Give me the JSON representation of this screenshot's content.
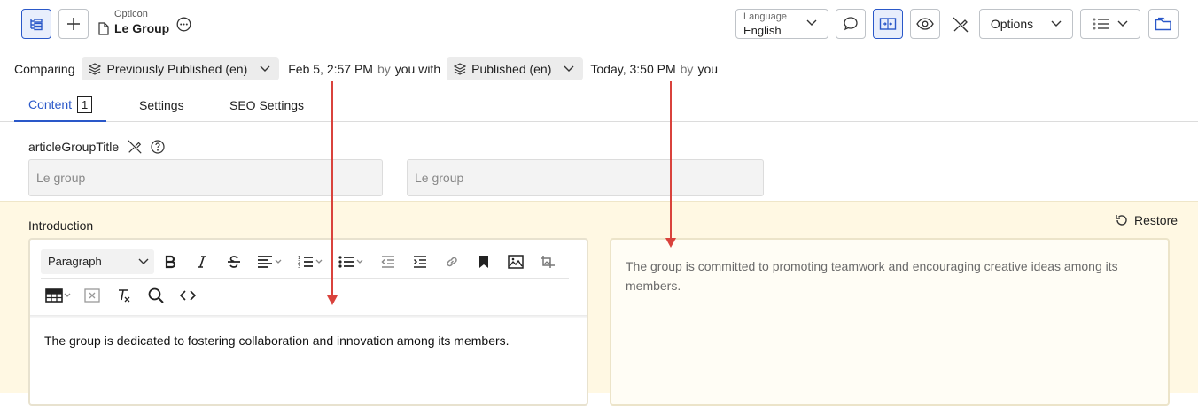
{
  "header": {
    "breadcrumb": "Opticon",
    "title": "Le Group",
    "language_label": "Language",
    "language_value": "English",
    "options_label": "Options"
  },
  "compare": {
    "label": "Comparing",
    "left_version": "Previously Published (en)",
    "left_date": "Feb 5, 2:57 PM",
    "left_by": "by",
    "left_user": "you with",
    "right_version": "Published (en)",
    "right_date": "Today, 3:50 PM",
    "right_by": "by",
    "right_user": "you"
  },
  "tabs": [
    {
      "label": "Content",
      "badge": "1"
    },
    {
      "label": "Settings"
    },
    {
      "label": "SEO Settings"
    }
  ],
  "fields": {
    "title_label": "articleGroupTitle",
    "title_left": "Le group",
    "title_right": "Le group",
    "intro_label": "Introduction",
    "restore_label": "Restore",
    "paragraph_label": "Paragraph",
    "intro_left": "The group is dedicated to fostering collaboration and innovation among its members.",
    "intro_right": "The group is committed to promoting teamwork and encouraging creative ideas among its members."
  },
  "colors": {
    "accent": "#2a58c9",
    "compare_bg": "#fff8e3",
    "arrow": "#d9423c"
  }
}
